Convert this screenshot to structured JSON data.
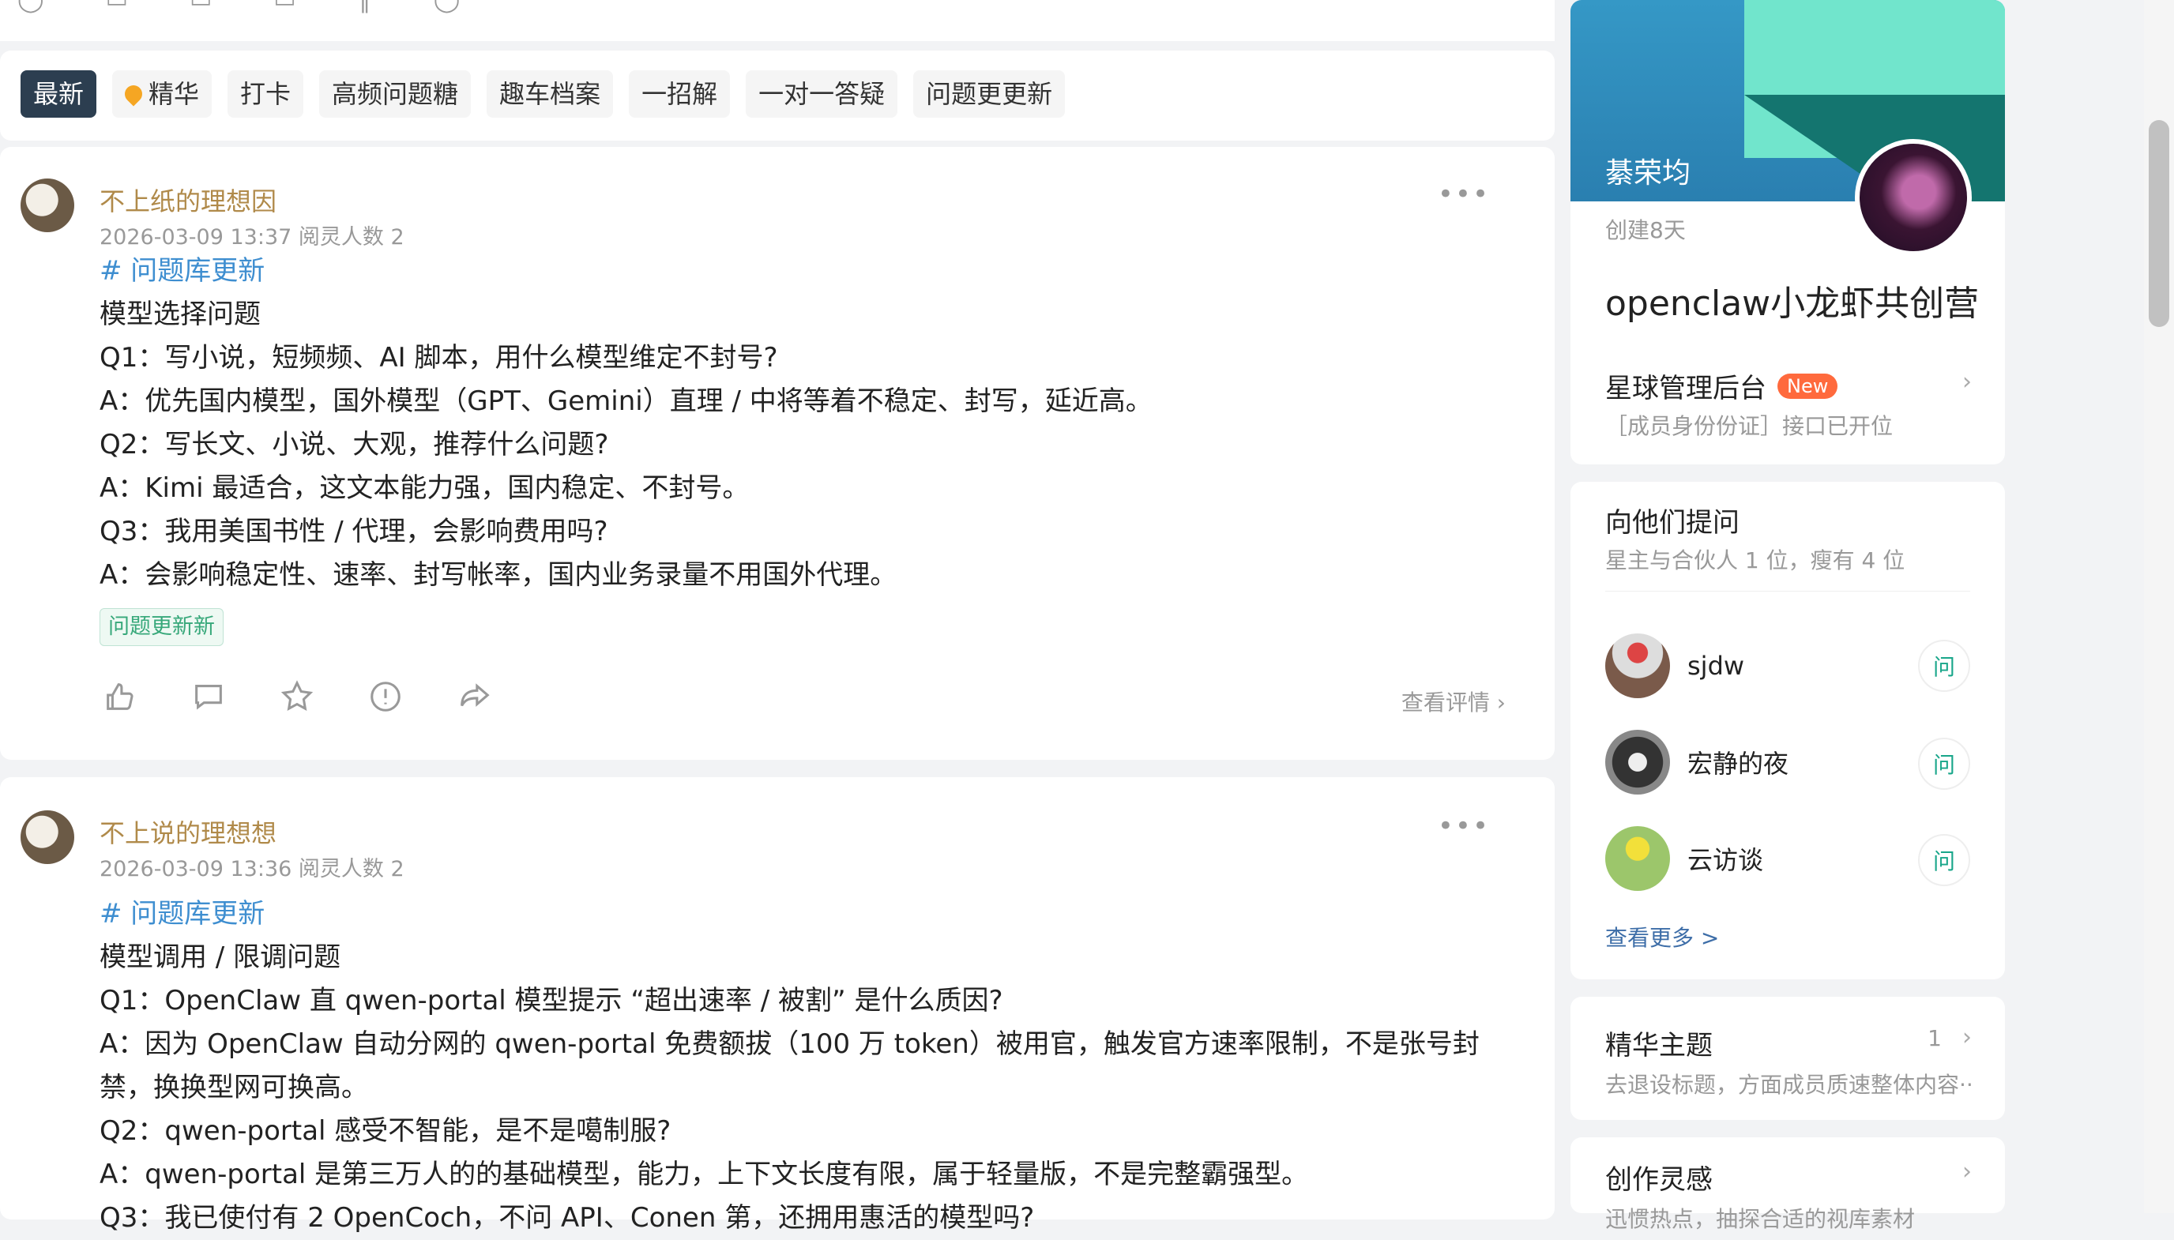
{
  "tabs": [
    {
      "label": "最新"
    },
    {
      "label": "精华",
      "icon": "gem-icon"
    },
    {
      "label": "打卡"
    },
    {
      "label": "高频问题糖"
    },
    {
      "label": "趣车档案"
    },
    {
      "label": "一招解"
    },
    {
      "label": "一对一答疑"
    },
    {
      "label": "问题更更新"
    }
  ],
  "posts": [
    {
      "author": "不上纸的理想因",
      "meta": "2026-03-09 13:37   阅灵人数 2",
      "hashtag": "# 问题库更新",
      "lines": [
        "模型选择问题",
        "Q1：写小说，短频频、AI 脚本，用什么模型维定不封号?",
        "A：优先国内模型，国外模型（GPT、Gemini）直理 / 中将等着不稳定、封写，延近高。",
        "Q2：写长文、小说、大观，推荐什么问题?",
        "A：Kimi 最适合，这文本能力强，国内稳定、不封号。",
        "Q3：我用美国书性 / 代理，会影响费用吗?",
        "A：会影响稳定性、速率、封写帐率，国内业务录量不用国外代理。"
      ],
      "tag": "问题更新新",
      "view_link": "查看评情 ›"
    },
    {
      "author": "不上说的理想想",
      "meta": "2026-03-09 13:36   阅灵人数 2",
      "hashtag": "# 问题库更新",
      "lines": [
        "模型调用 / 限调问题",
        "Q1：OpenClaw 直 qwen-portal 模型提示 “超出速率 / 被割” 是什么质因?",
        "A：因为 OpenClaw 自动分网的 qwen-portal 免费额拔（100 万 token）被用官，触发官方速率限制，不是张号封禁，换换型网可换高。",
        "Q2：qwen-portal 感受不智能，是不是噶制服?",
        "A：qwen-portal 是第三万人的的基础模型，能力，上下文长度有限，属于轻量版，不是完整霸强型。",
        "Q3：我已使付有 2 OpenCoch，不问 API、Conen 第，还拥用惠活的模型吗?"
      ]
    }
  ],
  "community": {
    "owner": "綦荣均",
    "created": "创建8天",
    "name": "openclaw小龙虾共创营",
    "admin_label": "星球管理后台",
    "new_badge": "New",
    "admin_sub": "［成员身份份证］接口已开位"
  },
  "ask": {
    "title": "向他们提问",
    "subtitle": "星主与合伙人 1 位，瘦有 4 位",
    "people": [
      {
        "name": "sjdw",
        "ask": "问"
      },
      {
        "name": "宏静的夜",
        "ask": "问"
      },
      {
        "name": "云访谈",
        "ask": "问"
      }
    ],
    "more": "查看更多 >"
  },
  "featured": {
    "title": "精华主题",
    "count": "1",
    "desc": "去退设标题，方面成员质速整体内容··"
  },
  "inspiration": {
    "title": "创作灵感",
    "desc": "迅惯热点，抽探合适的视库素材"
  },
  "colors": {
    "accent": "#2c3e50",
    "author": "#b08a4a",
    "hashtag": "#3e8ed0",
    "ask": "#19a68a"
  }
}
